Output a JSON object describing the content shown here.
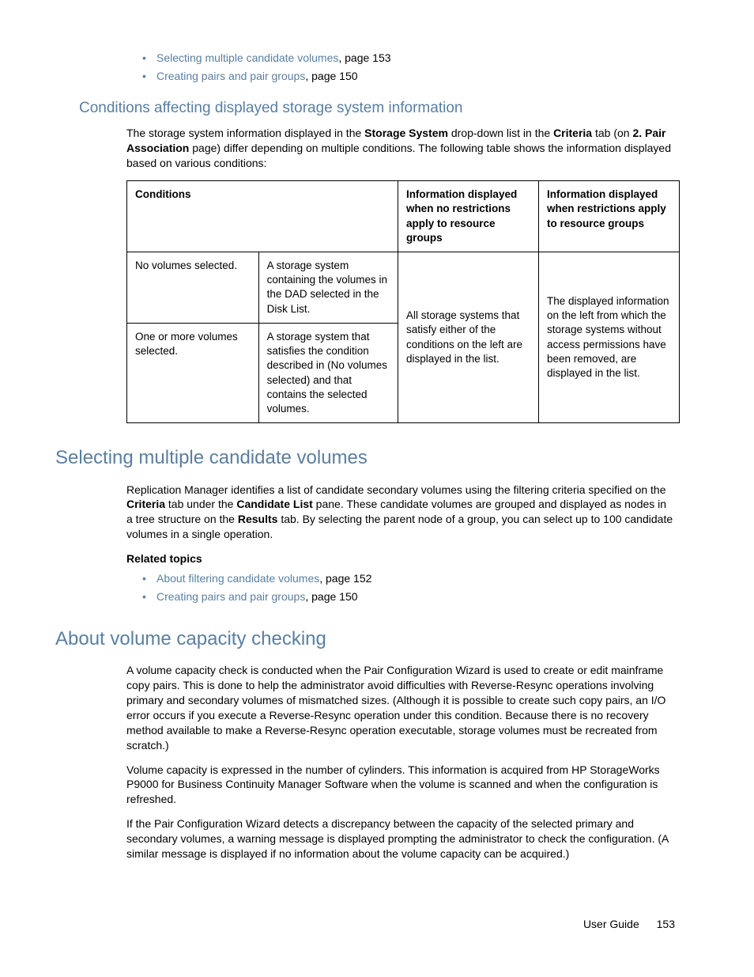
{
  "top_links": [
    {
      "text": "Selecting multiple candidate volumes",
      "page": ", page 153"
    },
    {
      "text": "Creating pairs and pair groups",
      "page": ", page 150"
    }
  ],
  "section1": {
    "heading": "Conditions affecting displayed storage system information",
    "para_pre": "The storage system information displayed in the ",
    "para_b1": "Storage System",
    "para_mid1": " drop-down list in the ",
    "para_b2": "Criteria",
    "para_mid2": " tab (on ",
    "para_b3": "2. Pair Association",
    "para_post": " page) differ depending on multiple conditions. The following table shows the information displayed based on various conditions:"
  },
  "table": {
    "h1": "Conditions",
    "h2": "Information displayed when no restrictions apply to resource groups",
    "h3": "Information displayed when restrictions apply to resource groups",
    "r1c1": "No volumes selected.",
    "r1c2": "A storage system containing the volumes in the DAD selected in the Disk List.",
    "r2c1": "One or more volumes selected.",
    "r2c2": "A storage system that satisfies the condition described in (No volumes selected) and that contains the selected volumes.",
    "merge_c3": "All storage systems that satisfy either of the conditions on the left are displayed in the list.",
    "merge_c4": "The displayed information on the left from which the storage systems without access permissions have been removed, are displayed in the list."
  },
  "section2": {
    "heading": "Selecting multiple candidate volumes",
    "p_pre": "Replication Manager identifies a list of candidate secondary volumes using the filtering criteria specified on the ",
    "p_b1": "Criteria",
    "p_mid1": " tab under the ",
    "p_b2": "Candidate List",
    "p_mid2": " pane. These candidate volumes are grouped and displayed as nodes in a tree structure on the ",
    "p_b3": "Results",
    "p_post": " tab.  By selecting the parent node of a group, you can select up to 100 candidate volumes in a single operation.",
    "related": "Related topics",
    "links": [
      {
        "text": "About filtering candidate volumes",
        "page": ", page 152"
      },
      {
        "text": "Creating pairs and pair groups",
        "page": ", page 150"
      }
    ]
  },
  "section3": {
    "heading": "About volume capacity checking",
    "p1": "A volume capacity check is conducted when the Pair Configuration Wizard is used to create or edit mainframe copy pairs. This is done to help the administrator avoid difficulties with Reverse-Resync operations involving primary and secondary volumes of mismatched sizes. (Although it is possible to create such copy pairs, an I/O error occurs if you execute a Reverse-Resync operation under this condition. Because there is no recovery method available to make a Reverse-Resync operation executable, storage volumes must be recreated from scratch.)",
    "p2": "Volume capacity is expressed in the number of cylinders. This information is acquired from HP StorageWorks P9000 for Business Continuity Manager Software when the volume is scanned and when the configuration is refreshed.",
    "p3": "If the Pair Configuration Wizard detects a discrepancy between the capacity of the selected primary and secondary volumes, a warning message is displayed prompting the administrator to check the configuration. (A similar message is displayed if no information about the volume capacity can be acquired.)"
  },
  "footer": {
    "label": "User Guide",
    "page": "153"
  }
}
